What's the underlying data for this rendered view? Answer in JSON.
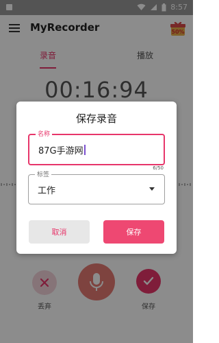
{
  "status_bar": {
    "time": "8:57"
  },
  "app_bar": {
    "title": "MyRecorder",
    "promo_badge": "50%"
  },
  "tabs": [
    {
      "label": "录音"
    },
    {
      "label": "播放"
    }
  ],
  "recorder": {
    "timer": "00:16:94"
  },
  "controls": {
    "discard_label": "丢弃",
    "save_label": "保存"
  },
  "dialog": {
    "title": "保存录音",
    "name_field": {
      "label": "名称",
      "value": "87G手游网",
      "counter": "6/50"
    },
    "tag_field": {
      "label": "标签",
      "value": "工作"
    },
    "cancel_label": "取消",
    "save_label": "保存"
  },
  "colors": {
    "accent": "#e7356a",
    "mic": "#e57a74"
  }
}
